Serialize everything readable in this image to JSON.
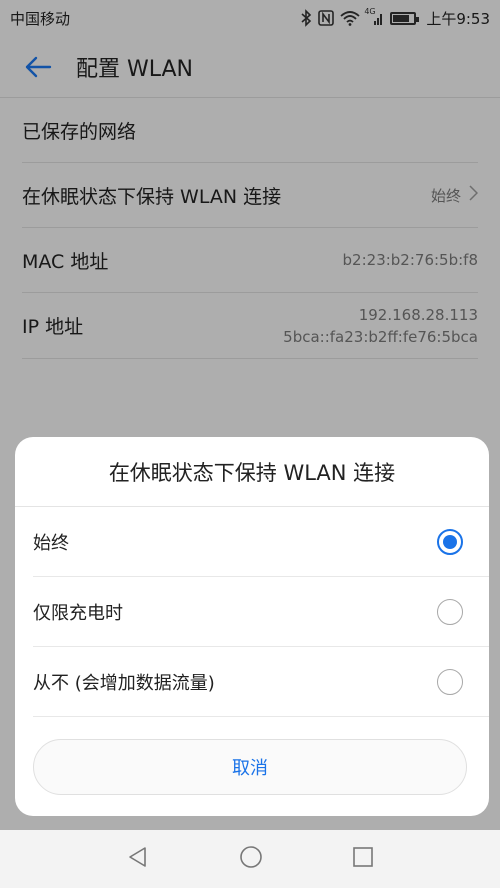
{
  "statusbar": {
    "carrier": "中国移动",
    "network": "4G",
    "time": "上午9:53",
    "battery_level": 0.8
  },
  "appbar": {
    "title": "配置 WLAN"
  },
  "settings": {
    "saved_networks": "已保存的网络",
    "sleep_label": "在休眠状态下保持 WLAN 连接",
    "sleep_value": "始终",
    "mac_label": "MAC 地址",
    "mac_value": "b2:23:b2:76:5b:f8",
    "ip_label": "IP 地址",
    "ip_v4": "192.168.28.113",
    "ip_v6": "5bca::fa23:b2ff:fe76:5bca"
  },
  "dialog": {
    "title": "在休眠状态下保持 WLAN 连接",
    "options": [
      {
        "label": "始终",
        "selected": true
      },
      {
        "label": "仅限充电时",
        "selected": false
      },
      {
        "label": "从不 (会增加数据流量)",
        "selected": false
      }
    ],
    "cancel": "取消"
  },
  "colors": {
    "accent": "#1a73e8"
  },
  "icons": [
    "back-arrow-icon",
    "bluetooth-icon",
    "nfc-icon",
    "wifi-icon",
    "signal-icon",
    "battery-icon",
    "nav-back-icon",
    "nav-home-icon",
    "nav-recents-icon",
    "chevron-right-icon"
  ]
}
